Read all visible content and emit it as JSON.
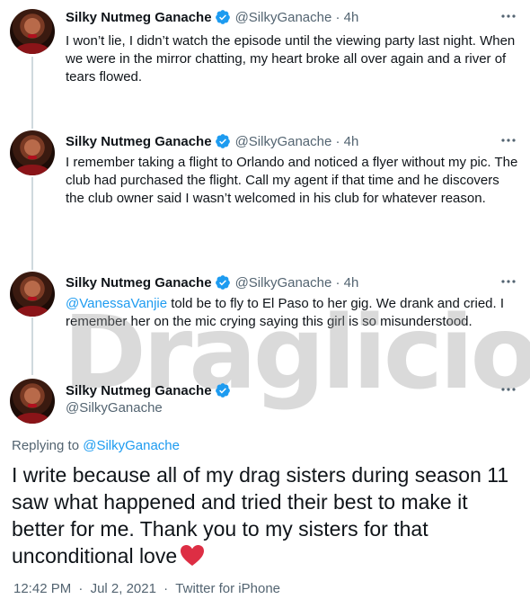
{
  "author": {
    "name": "Silky Nutmeg Ganache",
    "handle": "@SilkyGanache"
  },
  "tweets": [
    {
      "time": "@SilkyGanache · 4h",
      "text": "I won’t lie, I didn’t watch the episode until the viewing party last night. When we were in the mirror chatting, my heart broke all over again and a river of tears flowed."
    },
    {
      "time": "@SilkyGanache · 4h",
      "text": "I remember taking a flight to Orlando and noticed a flyer without my pic. The club had purchased the flight. Call my agent if that time and he discovers  the club owner said I wasn’t welcomed in his club for whatever reason."
    },
    {
      "time": "@SilkyGanache · 4h",
      "mention": "@VanessaVanjie",
      "text": " told be to fly to El Paso to her gig. We drank and cried. I remember her on the mic crying saying this girl is so misunderstood."
    }
  ],
  "main_tweet": {
    "handle": "@SilkyGanache",
    "replying_prefix": "Replying to ",
    "replying_to": "@SilkyGanache",
    "text": "I write because all of my drag sisters during season 11 saw what happened and tried their best to make it better for me. Thank you to my sisters for that unconditional love",
    "time": "12:42 PM",
    "date": "Jul 2, 2021",
    "source": "Twitter for iPhone",
    "separator": "·"
  },
  "watermark": "Draglicious",
  "colors": {
    "text": "#0f1419",
    "secondary": "#536471",
    "link": "#1d9bf0",
    "verified": "#1d9bf0",
    "heart": "#e0245e",
    "thread_line": "#cfd9de"
  },
  "icons": {
    "verified": "verified-badge-icon",
    "more": "more-options-icon",
    "heart": "red-heart-icon"
  }
}
